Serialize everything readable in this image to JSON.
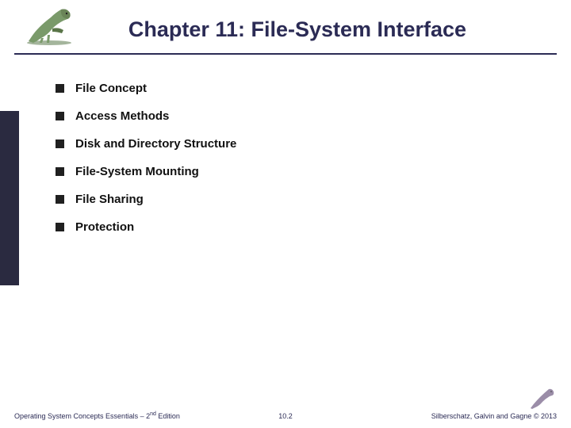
{
  "header": {
    "title": "Chapter 11:  File-System Interface"
  },
  "bullets": {
    "items": [
      {
        "label": "File Concept"
      },
      {
        "label": "Access Methods"
      },
      {
        "label": "Disk and Directory Structure"
      },
      {
        "label": "File-System Mounting"
      },
      {
        "label": "File Sharing"
      },
      {
        "label": "Protection"
      }
    ]
  },
  "footer": {
    "left_prefix": "Operating System Concepts Essentials – 2",
    "left_suffix": " Edition",
    "left_ordinal": "nd",
    "center": "10.2",
    "right": "Silberschatz, Galvin and Gagne © 2013"
  },
  "colors": {
    "accent": "#2b2b55",
    "sidebar": "#2a2a40",
    "bullet": "#202020"
  }
}
